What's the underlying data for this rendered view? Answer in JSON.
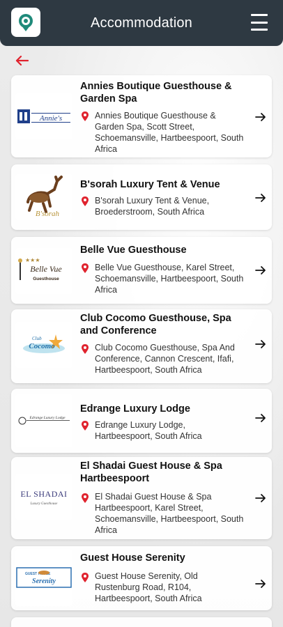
{
  "header": {
    "title": "Accommodation"
  },
  "colors": {
    "header_bg": "#2e3942",
    "accent_red": "#e0232e",
    "logo_teal": "#1f8a7a"
  },
  "icons": {
    "app_logo": "location-pin-logo-icon",
    "menu": "hamburger-menu-icon",
    "back": "back-arrow-icon",
    "pin": "map-pin-icon",
    "go": "arrow-right-icon"
  },
  "listings": [
    {
      "name": "Annies Boutique Guesthouse & Garden Spa",
      "address": "Annies Boutique Guesthouse & Garden Spa, Scott Street, Schoemansville, Hartbeespoort, South Africa",
      "logo_text": "Annie's"
    },
    {
      "name": "B'sorah Luxury Tent & Venue",
      "address": "B'sorah Luxury Tent & Venue, Broederstroom, South Africa",
      "logo_text": "B'sorah"
    },
    {
      "name": "Belle Vue Guesthouse",
      "address": "Belle Vue Guesthouse, Karel Street, Schoemansville, Hartbeespoort, South Africa",
      "logo_text": "Belle Vue",
      "logo_sub": "Guesthouse"
    },
    {
      "name": "Club Cocomo Guesthouse, Spa and Conference",
      "address": "Club Cocomo Guesthouse, Spa And Conference, Cannon Crescent, Ifafi, Hartbeespoort, South Africa",
      "logo_text": "Cocomo",
      "logo_sub": "Club"
    },
    {
      "name": "Edrange Luxury Lodge",
      "address": "Edrange Luxury Lodge, Hartbeespoort, South Africa",
      "logo_text": "Edrange Luxury Lodge"
    },
    {
      "name": "El Shadai Guest House & Spa Hartbeespoort",
      "address": "El Shadai Guest House & Spa Hartbeespoort, Karel Street, Schoemansville, Hartbeespoort, South Africa",
      "logo_text": "EL SHADAI",
      "logo_sub": "Luxury Guesthouse"
    },
    {
      "name": "Guest House Serenity",
      "address": "Guest House Serenity, Old Rustenburg Road, R104, Hartbeespoort, South Africa",
      "logo_text": "Serenity",
      "logo_sub": "GUEST HOUSE"
    }
  ]
}
